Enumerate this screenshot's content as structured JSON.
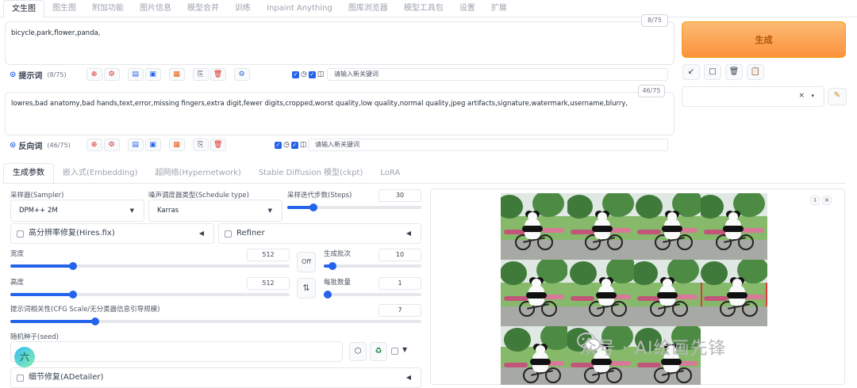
{
  "top_tabs": [
    "文生图",
    "图生图",
    "附加功能",
    "图片信息",
    "模型合并",
    "训练",
    "Inpaint Anything",
    "图库浏览器",
    "模型工具包",
    "设置",
    "扩展"
  ],
  "prompt": {
    "text": "bicycle,park,flower,panda,",
    "counter": "8/75",
    "label": "提示词",
    "count": "(8/75)",
    "keyword_placeholder": "请输入新关键词"
  },
  "negative": {
    "text": "lowres,bad anatomy,bad hands,text,error,missing fingers,extra digit,fewer digits,cropped,worst quality,low quality,normal quality,jpeg artifacts,signature,watermark,username,blurry,",
    "counter": "46/75",
    "label": "反向词",
    "count": "(46/75)",
    "keyword_placeholder": "请输入新关键词"
  },
  "generate_label": "生成",
  "right_tools": [
    "↙",
    "□",
    "🗑",
    "📋"
  ],
  "style_select": {
    "clear": "×",
    "caret": "▾"
  },
  "param_tabs": [
    "生成参数",
    "嵌入式(Embedding)",
    "超网络(Hypernetwork)",
    "Stable Diffusion 模型(ckpt)",
    "LoRA"
  ],
  "sampler": {
    "label": "采样器(Sampler)",
    "value": "DPM++ 2M"
  },
  "schedule": {
    "label": "噪声调度器类型(Schedule type)",
    "value": "Karras"
  },
  "steps": {
    "label": "采样迭代步数(Steps)",
    "value": 30,
    "min": 1,
    "max": 150
  },
  "hires": {
    "label": "高分辨率修复(Hires.fix)"
  },
  "refiner": {
    "label": "Refiner"
  },
  "width": {
    "label": "宽度",
    "value": 512,
    "min": 64,
    "max": 2048
  },
  "height": {
    "label": "高度",
    "value": 512,
    "min": 64,
    "max": 2048
  },
  "batch_count": {
    "label": "生成批次",
    "value": 10,
    "min": 1,
    "max": 100
  },
  "batch_size": {
    "label": "每批数量",
    "value": 1,
    "min": 1,
    "max": 8
  },
  "off_label": "Off",
  "swap_label": "⇅",
  "cfg": {
    "label": "提示词相关性(CFG Scale/无分类器信息引导规模)",
    "value": 7,
    "min": 1,
    "max": 30
  },
  "seed": {
    "label": "随机种子(seed)",
    "avatar": "六"
  },
  "adetailer": {
    "label": "细节修复(ADetailer)"
  },
  "gallery": {
    "download": "⇩",
    "close": "×",
    "image_count": 11,
    "selected_index": 7
  },
  "watermark": "众号 · AI绘画先锋",
  "colors": {
    "accent": "#2563eb",
    "generate": "#fb923c",
    "danger": "#dc2626",
    "select_outline": "#e03a3a"
  }
}
